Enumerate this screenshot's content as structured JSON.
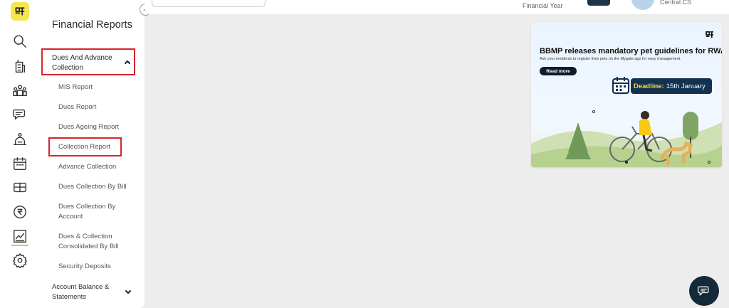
{
  "sidebar_icons": [
    "logo",
    "search-icon",
    "building-icon",
    "residents-icon",
    "chat-icon",
    "helpdesk-icon",
    "calendar-icon",
    "amenities-icon",
    "rupee-icon",
    "reports-icon",
    "settings-icon"
  ],
  "panel": {
    "title": "Financial Reports",
    "group_label": "Dues And Advance Collection",
    "items": [
      "MIS Report",
      "Dues Report",
      "Dues Ageing Report",
      "Collection Report",
      "Advance Collection",
      "Dues Collection By Bill",
      "Dues Collection By Account",
      "Dues & Collection Consolidated By Bill",
      "Security Deposits"
    ],
    "selected_item": "Collection Report",
    "group2_label": "Account Balance & Statements"
  },
  "topbar": {
    "fy_label": "Financial Year",
    "user_label": "Central CS"
  },
  "banner": {
    "headline": "BBMP releases mandatory pet guidelines for RWAs",
    "sub": "Ask your residents to register their pets on the Mygate app for easy management.",
    "read_more": "Read more",
    "deadline_label": "Deadline:",
    "deadline_value": "15th January"
  },
  "colors": {
    "highlight_border": "#d9232a",
    "logo_bg": "#f3e64f",
    "fab_bg": "#142a38"
  }
}
